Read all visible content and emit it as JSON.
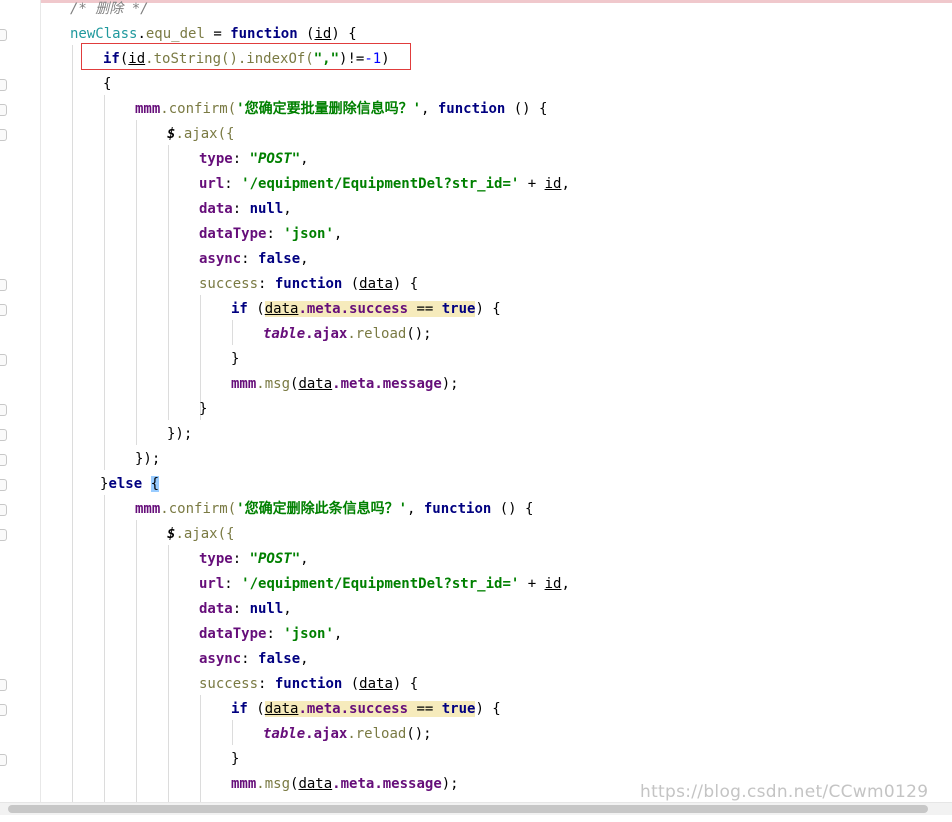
{
  "editor": {
    "comment": "/* 删除 */",
    "func_decl": {
      "obj": "newClass",
      "dot": ".",
      "name": "equ_del",
      "eq": " = ",
      "kw": "function",
      "open": " (",
      "param": "id",
      "close": ") {"
    },
    "if_line": {
      "kw": "if",
      "p1": "(",
      "var": "id",
      "m1": ".toString().indexOf(",
      "str": "\",\"",
      "m2": ")!=",
      "num": "-1",
      "p2": ")"
    },
    "open_brace": "{",
    "confirm1": {
      "obj": "mmm",
      "fn": ".confirm(",
      "msg": "'您确定要批量删除信息吗？'",
      "sep": ", ",
      "kw": "function",
      "tail": " () {"
    },
    "ajax_open": {
      "obj": "$",
      "fn": ".ajax({"
    },
    "type_line": {
      "key": "type",
      "colon": ": ",
      "val": "\"POST\"",
      "end": ","
    },
    "url_line": {
      "key": "url",
      "colon": ": ",
      "val": "'/equipment/EquipmentDel?str_id='",
      "plus": " + ",
      "var": "id",
      "end": ","
    },
    "data_line": {
      "key": "data",
      "colon": ": ",
      "val": "null",
      "end": ","
    },
    "datatype_line": {
      "key": "dataType",
      "colon": ": ",
      "val": "'json'",
      "end": ","
    },
    "async_line": {
      "key": "async",
      "colon": ": ",
      "val": "false",
      "end": ","
    },
    "success_line": {
      "key": "success",
      "colon": ": ",
      "kw": "function",
      "open": " (",
      "param": "data",
      "close": ") {"
    },
    "if_success": {
      "kw": "if",
      "open": " (",
      "var": "data",
      "prop": ".meta.success",
      "op": " == ",
      "val": "true",
      "close": ") {"
    },
    "reload_line": {
      "glob": "table",
      "prop": ".ajax",
      "fn": ".reload",
      "end": "();"
    },
    "close_brace": "}",
    "msg_line": {
      "obj": "mmm",
      "fn": ".msg",
      "open": "(",
      "var": "data",
      "prop": ".meta.message",
      "end": ");"
    },
    "close_ajax": "});",
    "else_line": {
      "close": "}",
      "kw": "else",
      "space": " ",
      "brace": "{"
    },
    "confirm2": {
      "obj": "mmm",
      "fn": ".confirm(",
      "msg": "'您确定删除此条信息吗？'",
      "sep": ", ",
      "kw": "function",
      "tail": " () {"
    }
  },
  "watermark": "https://blog.csdn.net/CCwm0129",
  "colors": {
    "keyword": "#000080",
    "string": "#008000",
    "property": "#660e7a",
    "highlight": "#f6ebbc",
    "selection_box": "#e03c3c"
  }
}
